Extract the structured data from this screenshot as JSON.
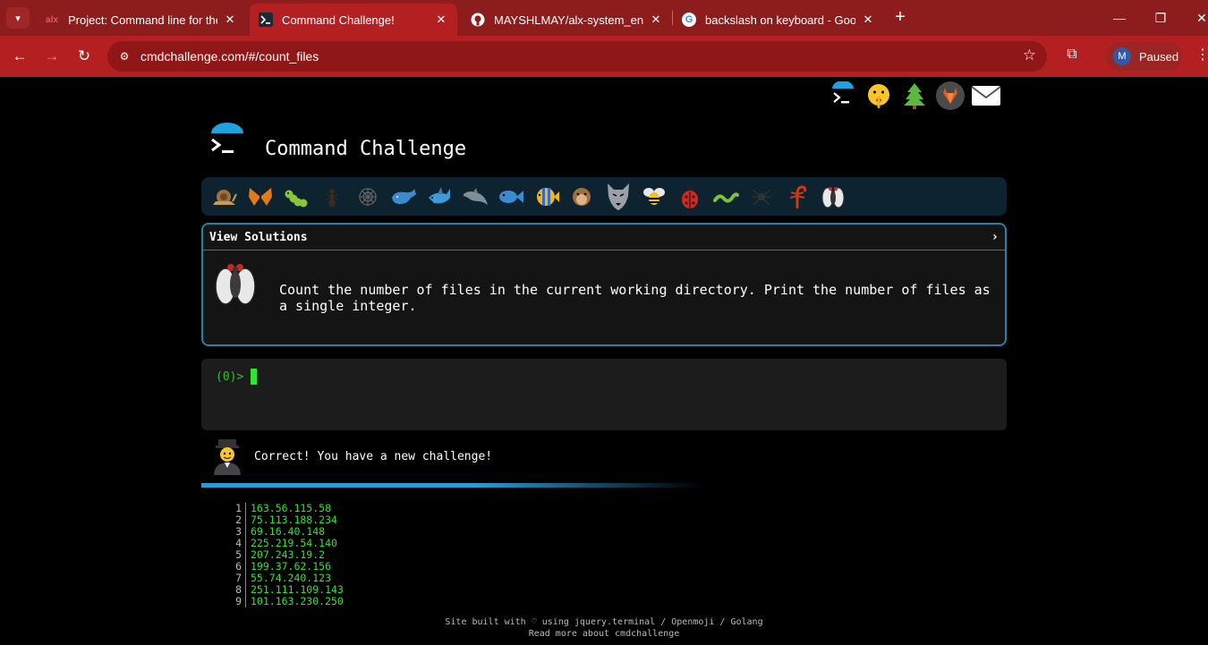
{
  "browser": {
    "tabs": [
      {
        "favicon": "alx-logo-icon",
        "title": "Project: Command line for the",
        "active": false
      },
      {
        "favicon": "terminal-icon",
        "title": "Command Challenge!",
        "active": true
      },
      {
        "favicon": "github-icon",
        "title": "MAYSHLMAY/alx-system_engi",
        "active": false
      },
      {
        "favicon": "google-icon",
        "title": "backslash on keyboard - Googl",
        "active": false
      }
    ],
    "favicon_glyphs": {
      "alx": "alx",
      "google": "G"
    },
    "url": "cmdchallenge.com/#/count_files",
    "profile_initial": "M",
    "profile_status": "Paused",
    "colors": {
      "tabbar": "#8d1d1d",
      "toolbar": "#b41f22",
      "omnibox": "#8f1717"
    }
  },
  "page": {
    "site_title": "Command Challenge",
    "top_links": [
      "terminal-icon",
      "shushing-face-icon",
      "evergreen-tree-icon",
      "gitlab-icon",
      "envelope-icon"
    ],
    "creatures": [
      "snail-icon",
      "butterfly-icon",
      "caterpillar-icon",
      "ant-icon",
      "spiderweb-icon",
      "whale-icon",
      "shark-icon",
      "dolphin-icon",
      "fish-icon",
      "tropical-fish-icon",
      "pufferfish-icon",
      "wolf-icon",
      "bee-icon",
      "ladybug-icon",
      "worm-icon",
      "spider-icon",
      "scorpion-icon",
      "fly-icon"
    ],
    "panel": {
      "header": "View Solutions",
      "chevron": "›",
      "challenge_text": "Count the number of files in the current working directory. Print the number of files as a single integer."
    },
    "terminal": {
      "prompt": "(0)>"
    },
    "feedback": {
      "message": "Correct! You have a new challenge!"
    },
    "output_lines": [
      {
        "n": "1",
        "ip": "163.56.115.58"
      },
      {
        "n": "2",
        "ip": "75.113.188.234"
      },
      {
        "n": "3",
        "ip": "69.16.40.148"
      },
      {
        "n": "4",
        "ip": "225.219.54.140"
      },
      {
        "n": "5",
        "ip": "207.243.19.2"
      },
      {
        "n": "6",
        "ip": "199.37.62.156"
      },
      {
        "n": "7",
        "ip": "55.74.240.123"
      },
      {
        "n": "8",
        "ip": "251.111.109.143"
      },
      {
        "n": "9",
        "ip": "101.163.230.250"
      }
    ],
    "footer": {
      "line1": "Site built with ♡ using jquery.terminal / Openmoji / Golang",
      "line2": "Read more about cmdchallenge"
    },
    "colors": {
      "accent": "#2a7fa3",
      "prompt_green": "#2fc02f",
      "output_green": "#34e234"
    }
  }
}
